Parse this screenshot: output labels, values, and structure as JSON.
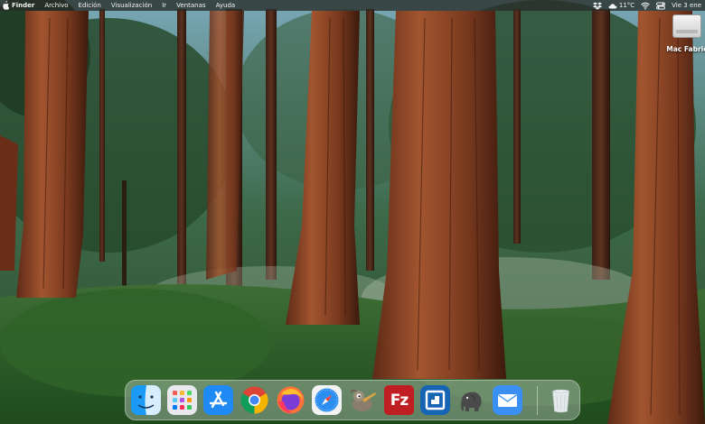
{
  "menubar": {
    "apple_icon": "apple-logo-icon",
    "app_name": "Finder",
    "menus": [
      "Archivo",
      "Edición",
      "Visualización",
      "Ir",
      "Ventanas",
      "Ayuda"
    ],
    "status": {
      "icons": [
        "dropbox-icon",
        "cloud-icon",
        "wifi-icon",
        "control-center-icon"
      ],
      "temperature": "11°C",
      "clock": "Vie 3 ene"
    }
  },
  "desktop": {
    "drive_label": "Mac Fabric"
  },
  "dock": {
    "apps": [
      {
        "name": "Finder",
        "icon": "finder-icon"
      },
      {
        "name": "Launchpad",
        "icon": "launchpad-icon"
      },
      {
        "name": "App Store",
        "icon": "app-store-icon"
      },
      {
        "name": "Google Chrome",
        "icon": "chrome-icon"
      },
      {
        "name": "Firefox",
        "icon": "firefox-icon"
      },
      {
        "name": "Safari",
        "icon": "safari-icon"
      },
      {
        "name": "GIMP",
        "icon": "gimp-icon"
      },
      {
        "name": "FileZilla",
        "icon": "filezilla-icon",
        "text": "Fz"
      },
      {
        "name": "Remote Desktop",
        "icon": "remote-desktop-icon"
      },
      {
        "name": "TablePlus",
        "icon": "elephant-icon"
      },
      {
        "name": "Mail",
        "icon": "mail-icon"
      }
    ],
    "trash_icon": "trash-icon"
  },
  "colors": {
    "menubar_bg": "#2a2c2a",
    "app_store_blue": "#1f8af3",
    "filezilla_red": "#bf1f22",
    "remote_desktop_blue": "#1665b5",
    "mail_blue": "#3a8ff5"
  }
}
